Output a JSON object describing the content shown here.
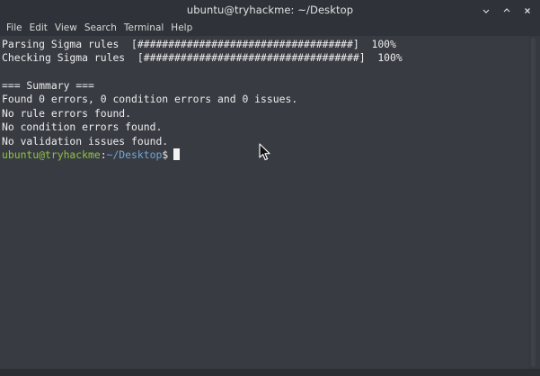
{
  "window": {
    "title": "ubuntu@tryhackme: ~/Desktop",
    "controls": [
      "minimize-icon",
      "maximize-icon",
      "close-icon"
    ]
  },
  "menubar": {
    "items": [
      "File",
      "Edit",
      "View",
      "Search",
      "Terminal",
      "Help"
    ]
  },
  "terminal": {
    "lines": [
      "Parsing Sigma rules  [###################################]  100%",
      "Checking Sigma rules  [###################################]  100%",
      "",
      "=== Summary ===",
      "Found 0 errors, 0 condition errors and 0 issues.",
      "No rule errors found.",
      "No condition errors found.",
      "No validation issues found."
    ],
    "prompt": {
      "user_host": "ubuntu@tryhackme",
      "separator": ":",
      "path": "~/Desktop",
      "symbol": "$"
    }
  },
  "colors": {
    "background": "#393b42",
    "titlebar": "#2f3238",
    "text": "#ededed",
    "prompt_user": "#8ec63f",
    "prompt_path": "#6fa7d6"
  }
}
